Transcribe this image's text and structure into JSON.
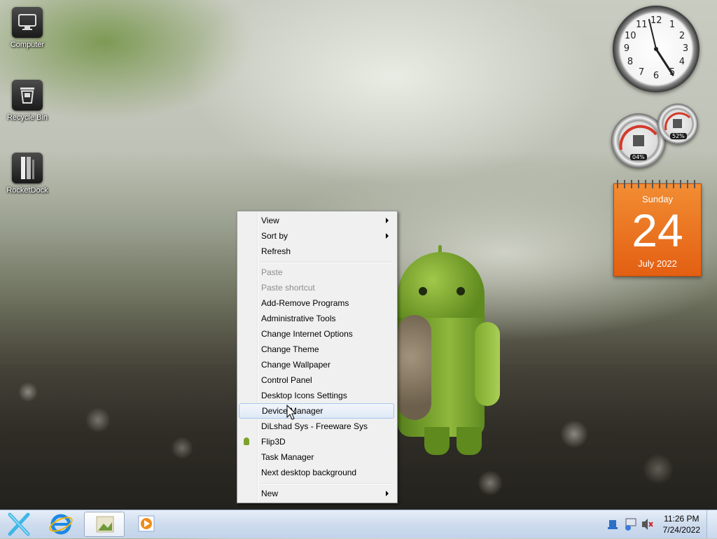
{
  "desktop": {
    "icons": [
      {
        "label": "Computer"
      },
      {
        "label": "Recycle Bin"
      },
      {
        "label": "RocketDock"
      }
    ]
  },
  "gadgets": {
    "clock": {
      "numerals": [
        "12",
        "1",
        "2",
        "3",
        "4",
        "5",
        "6",
        "7",
        "8",
        "9",
        "10",
        "11"
      ]
    },
    "meter": {
      "cpu_percent": "04%",
      "memory_percent": "52%"
    },
    "calendar": {
      "weekday": "Sunday",
      "day": "24",
      "month_year": "July 2022"
    }
  },
  "context_menu": {
    "items": [
      {
        "label": "View"
      },
      {
        "label": "Sort by"
      },
      {
        "label": "Refresh"
      },
      {
        "label": "Paste"
      },
      {
        "label": "Paste shortcut"
      },
      {
        "label": "Add-Remove Programs"
      },
      {
        "label": "Administrative Tools"
      },
      {
        "label": "Change Internet Options"
      },
      {
        "label": "Change Theme"
      },
      {
        "label": "Change Wallpaper"
      },
      {
        "label": "Control Panel"
      },
      {
        "label": "Desktop Icons Settings"
      },
      {
        "label": "Device Manager"
      },
      {
        "label": "DiLshad Sys - Freeware Sys"
      },
      {
        "label": "Flip3D"
      },
      {
        "label": "Task Manager"
      },
      {
        "label": "Next desktop background"
      },
      {
        "label": "New"
      }
    ],
    "highlighted": "Device Manager"
  },
  "taskbar": {
    "time": "11:26 PM",
    "date": "7/24/2022"
  },
  "colors": {
    "calendar_orange": "#e86a1c",
    "menu_highlight": "#dfe9f6",
    "taskbar": "#cfdcee"
  }
}
